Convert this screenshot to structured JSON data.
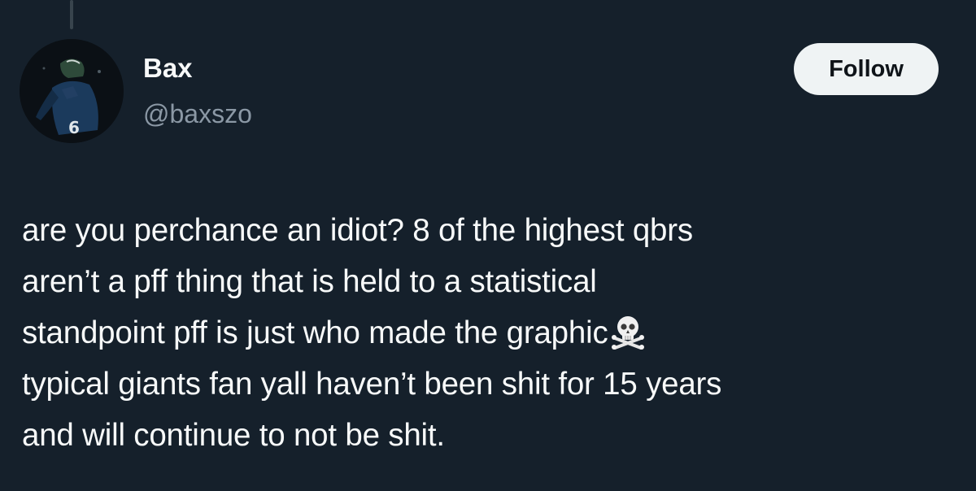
{
  "author": {
    "display_name": "Bax",
    "handle": "@baxszo",
    "avatar_jersey_number": "6"
  },
  "actions": {
    "follow_label": "Follow"
  },
  "tweet": {
    "lines": [
      "are you perchance an idiot? 8 of the highest qbrs",
      "aren’t a pff thing that is held to a statistical",
      "standpoint pff is just who made the graphic",
      "typical giants fan yall haven’t been shit for 15 years",
      "and will continue to not be shit."
    ],
    "emoji": "skull-and-crossbones-icon"
  },
  "colors": {
    "background": "#15202b",
    "text": "#f7f9f9",
    "secondary_text": "#8b98a5",
    "button_bg": "#eff3f4",
    "button_text": "#0f1419"
  }
}
